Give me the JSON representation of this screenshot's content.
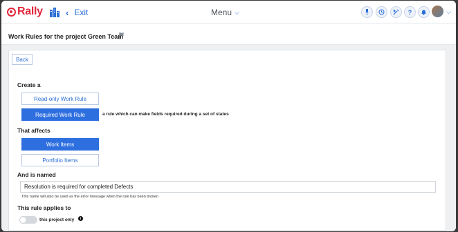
{
  "app": {
    "logo_text": "Rally",
    "brand_color": "#e0283c",
    "accent_color": "#2e6fe0"
  },
  "topbar": {
    "exit_label": "Exit",
    "menu_label": "Menu",
    "icons": [
      "pin-icon",
      "history-icon",
      "tools-icon",
      "help-icon",
      "bell-icon",
      "avatar"
    ]
  },
  "page": {
    "title": "Work Rules for the project Green Team"
  },
  "form": {
    "back_label": "Back",
    "create_label": "Create a",
    "readonly_rule_label": "Read-only Work Rule",
    "required_rule_label": "Required Work Rule",
    "required_rule_desc": "a rule which can make fields required during a set of states",
    "affects_label": "That affects",
    "work_items_label": "Work Items",
    "portfolio_items_label": "Portfolio Items",
    "named_label": "And is named",
    "name_value": "Resolution is required for completed Defects",
    "name_hint": "This name will also be used as the error message when the rule has been broken",
    "applies_label": "This rule applies to",
    "project_only_label": "this project only",
    "project_only_enabled": false
  }
}
